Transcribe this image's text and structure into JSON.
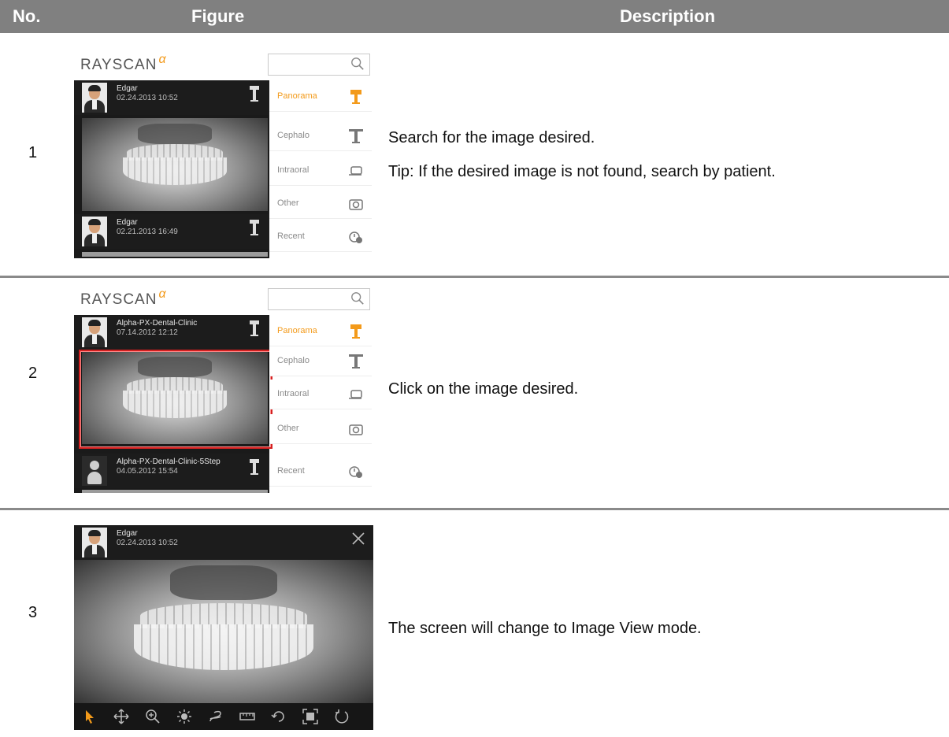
{
  "header": {
    "no": "No.",
    "figure": "Figure",
    "description": "Description"
  },
  "colors": {
    "accent": "#f39a1a",
    "header_bg": "#808080",
    "highlight": "#d32020"
  },
  "rows": [
    {
      "number": "1",
      "description": [
        "Search for the image desired.",
        "Tip: If the desired image is not found, search by patient."
      ],
      "figure": {
        "logo": "RAYSCAN",
        "patients": [
          {
            "name": "Edgar",
            "date": "02.24.2013 10:52"
          },
          {
            "name": "Edgar",
            "date": "02.21.2013 16:49"
          }
        ],
        "categories": [
          "Panorama",
          "Cephalo",
          "Intraoral",
          "Other",
          "Recent"
        ]
      }
    },
    {
      "number": "2",
      "description": [
        "Click on the image desired."
      ],
      "figure": {
        "logo": "RAYSCAN",
        "patients": [
          {
            "name": "Alpha-PX-Dental-Clinic",
            "date": "07.14.2012 12:12"
          },
          {
            "name": "Alpha-PX-Dental-Clinic-5Step",
            "date": "04.05.2012 15:54"
          }
        ],
        "categories": [
          "Panorama",
          "Cephalo",
          "Intraoral",
          "Other",
          "Recent"
        ]
      }
    },
    {
      "number": "3",
      "description": [
        "The screen will change to Image View mode."
      ],
      "figure": {
        "patient": {
          "name": "Edgar",
          "date": "02.24.2013 10:52"
        },
        "tools": [
          "pointer-icon",
          "pan-icon",
          "zoom-icon",
          "brightness-icon",
          "curve-icon",
          "ruler-icon",
          "rotate-icon",
          "fit-icon",
          "reset-icon"
        ]
      }
    }
  ]
}
